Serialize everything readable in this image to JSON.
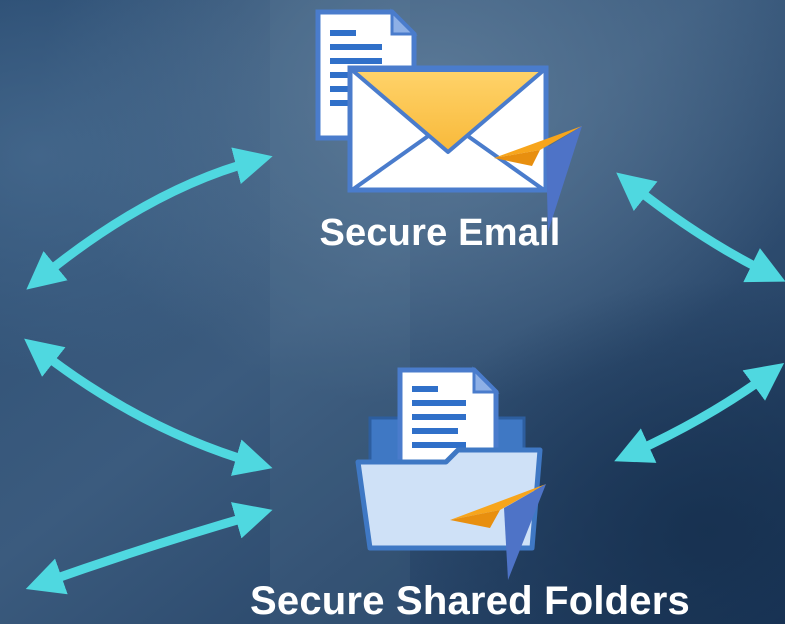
{
  "nodes": {
    "email": {
      "label": "Secure Email",
      "icon": "email-icon"
    },
    "folders": {
      "label": "Secure Shared Folders",
      "icon": "shared-folder-icon"
    }
  },
  "colors": {
    "background_dark": "#1d3a5e",
    "background_light": "#4e6d8c",
    "arrow": "#4fd8e0",
    "envelope_flap": "#ffc84a",
    "paper_plane_orange": "#f7a51c",
    "paper_plane_blue": "#4e73c7",
    "folder_back": "#3f78c4",
    "folder_front": "#cfe1f7",
    "document_lines": "#3070c9"
  }
}
